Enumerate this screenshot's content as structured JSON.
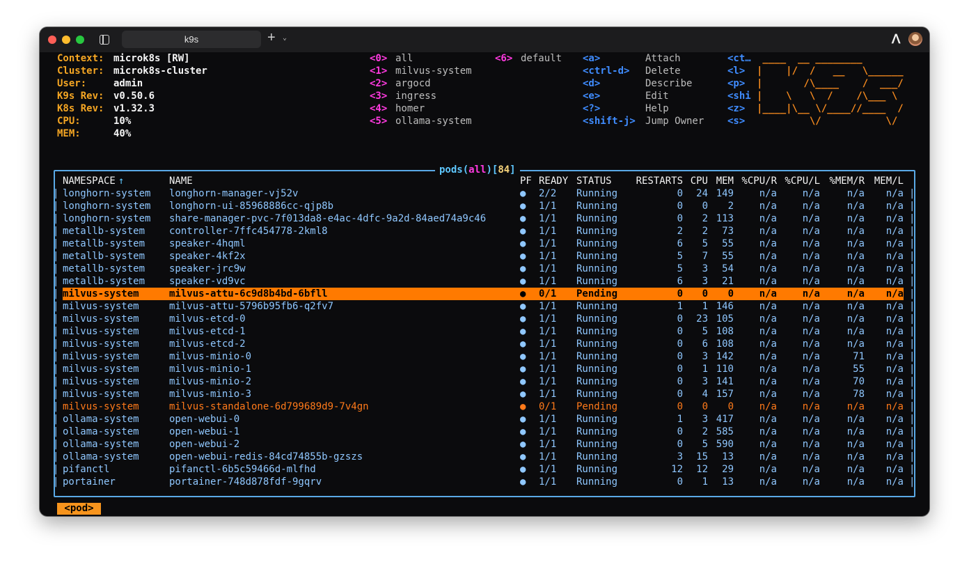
{
  "window": {
    "tab_title": "k9s"
  },
  "info": [
    {
      "label": "Context:",
      "value": "microk8s [RW]"
    },
    {
      "label": "Cluster:",
      "value": "microk8s-cluster"
    },
    {
      "label": "User:",
      "value": "admin"
    },
    {
      "label": "K9s Rev:",
      "value": "v0.50.6"
    },
    {
      "label": "K8s Rev:",
      "value": "v1.32.3"
    },
    {
      "label": "CPU:",
      "value": "10%"
    },
    {
      "label": "MEM:",
      "value": "40%"
    }
  ],
  "namespaces": [
    {
      "key": "<0>",
      "name": "all"
    },
    {
      "key": "<1>",
      "name": "milvus-system"
    },
    {
      "key": "<2>",
      "name": "argocd"
    },
    {
      "key": "<3>",
      "name": "ingress"
    },
    {
      "key": "<4>",
      "name": "homer"
    },
    {
      "key": "<5>",
      "name": "ollama-system"
    },
    {
      "key": "<6>",
      "name": "default"
    }
  ],
  "hotkeys": [
    {
      "key": "<a>",
      "action": "Attach"
    },
    {
      "key": "<ctrl-d>",
      "action": "Delete"
    },
    {
      "key": "<d>",
      "action": "Describe"
    },
    {
      "key": "<e>",
      "action": "Edit"
    },
    {
      "key": "<?>",
      "action": "Help"
    },
    {
      "key": "<shift-j>",
      "action": "Jump Owner"
    }
  ],
  "hotkeys2": [
    "<ct…",
    "<l>",
    "<p>",
    "<shi",
    "<z>",
    "<s>"
  ],
  "logo": [
    " ____  __ ________",
    "|    |/  /   __   \\______",
    "|       /\\____    /  ___/",
    "|    \\   \\  /    /\\___ \\",
    "|____|\\__ \\/____//____  /",
    "         \\/           \\/"
  ],
  "table": {
    "resource": "pods",
    "scope": "all",
    "count": "84",
    "headers": {
      "namespace": "NAMESPACE",
      "sort_arrow": "↑",
      "name": "NAME",
      "pf": "PF",
      "ready": "READY",
      "status": "STATUS",
      "restarts": "RESTARTS",
      "cpu": "CPU",
      "mem": "MEM",
      "cpu_r": "%CPU/R",
      "cpu_l": "%CPU/L",
      "mem_r": "%MEM/R",
      "mem_l": "MEM/L"
    },
    "rows": [
      {
        "ns": "longhorn-system",
        "name": "longhorn-manager-vj52v",
        "pf": "●",
        "ready": "2/2",
        "status": "Running",
        "restarts": "0",
        "cpu": "24",
        "mem": "149",
        "cpu_r": "n/a",
        "cpu_l": "n/a",
        "mem_r": "n/a",
        "mem_l": "n/a",
        "state": "ok"
      },
      {
        "ns": "longhorn-system",
        "name": "longhorn-ui-85968886cc-qjp8b",
        "pf": "●",
        "ready": "1/1",
        "status": "Running",
        "restarts": "0",
        "cpu": "0",
        "mem": "2",
        "cpu_r": "n/a",
        "cpu_l": "n/a",
        "mem_r": "n/a",
        "mem_l": "n/a",
        "state": "ok"
      },
      {
        "ns": "longhorn-system",
        "name": "share-manager-pvc-7f013da8-e4ac-4dfc-9a2d-84aed74a9c46",
        "pf": "●",
        "ready": "1/1",
        "status": "Running",
        "restarts": "0",
        "cpu": "2",
        "mem": "113",
        "cpu_r": "n/a",
        "cpu_l": "n/a",
        "mem_r": "n/a",
        "mem_l": "n/a",
        "state": "ok"
      },
      {
        "ns": "metallb-system",
        "name": "controller-7ffc454778-2kml8",
        "pf": "●",
        "ready": "1/1",
        "status": "Running",
        "restarts": "2",
        "cpu": "2",
        "mem": "73",
        "cpu_r": "n/a",
        "cpu_l": "n/a",
        "mem_r": "n/a",
        "mem_l": "n/a",
        "state": "ok"
      },
      {
        "ns": "metallb-system",
        "name": "speaker-4hqml",
        "pf": "●",
        "ready": "1/1",
        "status": "Running",
        "restarts": "6",
        "cpu": "5",
        "mem": "55",
        "cpu_r": "n/a",
        "cpu_l": "n/a",
        "mem_r": "n/a",
        "mem_l": "n/a",
        "state": "ok"
      },
      {
        "ns": "metallb-system",
        "name": "speaker-4kf2x",
        "pf": "●",
        "ready": "1/1",
        "status": "Running",
        "restarts": "5",
        "cpu": "7",
        "mem": "55",
        "cpu_r": "n/a",
        "cpu_l": "n/a",
        "mem_r": "n/a",
        "mem_l": "n/a",
        "state": "ok"
      },
      {
        "ns": "metallb-system",
        "name": "speaker-jrc9w",
        "pf": "●",
        "ready": "1/1",
        "status": "Running",
        "restarts": "5",
        "cpu": "3",
        "mem": "54",
        "cpu_r": "n/a",
        "cpu_l": "n/a",
        "mem_r": "n/a",
        "mem_l": "n/a",
        "state": "ok"
      },
      {
        "ns": "metallb-system",
        "name": "speaker-vd9vc",
        "pf": "●",
        "ready": "1/1",
        "status": "Running",
        "restarts": "6",
        "cpu": "3",
        "mem": "21",
        "cpu_r": "n/a",
        "cpu_l": "n/a",
        "mem_r": "n/a",
        "mem_l": "n/a",
        "state": "ok"
      },
      {
        "ns": "milvus-system",
        "name": "milvus-attu-6c9d8b4bd-6bfll",
        "pf": "●",
        "ready": "0/1",
        "status": "Pending",
        "restarts": "0",
        "cpu": "0",
        "mem": "0",
        "cpu_r": "n/a",
        "cpu_l": "n/a",
        "mem_r": "n/a",
        "mem_l": "n/a",
        "state": "selected"
      },
      {
        "ns": "milvus-system",
        "name": "milvus-attu-5796b95fb6-q2fv7",
        "pf": "●",
        "ready": "1/1",
        "status": "Running",
        "restarts": "1",
        "cpu": "1",
        "mem": "146",
        "cpu_r": "n/a",
        "cpu_l": "n/a",
        "mem_r": "n/a",
        "mem_l": "n/a",
        "state": "ok"
      },
      {
        "ns": "milvus-system",
        "name": "milvus-etcd-0",
        "pf": "●",
        "ready": "1/1",
        "status": "Running",
        "restarts": "0",
        "cpu": "23",
        "mem": "105",
        "cpu_r": "n/a",
        "cpu_l": "n/a",
        "mem_r": "n/a",
        "mem_l": "n/a",
        "state": "ok"
      },
      {
        "ns": "milvus-system",
        "name": "milvus-etcd-1",
        "pf": "●",
        "ready": "1/1",
        "status": "Running",
        "restarts": "0",
        "cpu": "5",
        "mem": "108",
        "cpu_r": "n/a",
        "cpu_l": "n/a",
        "mem_r": "n/a",
        "mem_l": "n/a",
        "state": "ok"
      },
      {
        "ns": "milvus-system",
        "name": "milvus-etcd-2",
        "pf": "●",
        "ready": "1/1",
        "status": "Running",
        "restarts": "0",
        "cpu": "6",
        "mem": "108",
        "cpu_r": "n/a",
        "cpu_l": "n/a",
        "mem_r": "n/a",
        "mem_l": "n/a",
        "state": "ok"
      },
      {
        "ns": "milvus-system",
        "name": "milvus-minio-0",
        "pf": "●",
        "ready": "1/1",
        "status": "Running",
        "restarts": "0",
        "cpu": "3",
        "mem": "142",
        "cpu_r": "n/a",
        "cpu_l": "n/a",
        "mem_r": "71",
        "mem_l": "n/a",
        "state": "ok"
      },
      {
        "ns": "milvus-system",
        "name": "milvus-minio-1",
        "pf": "●",
        "ready": "1/1",
        "status": "Running",
        "restarts": "0",
        "cpu": "1",
        "mem": "110",
        "cpu_r": "n/a",
        "cpu_l": "n/a",
        "mem_r": "55",
        "mem_l": "n/a",
        "state": "ok"
      },
      {
        "ns": "milvus-system",
        "name": "milvus-minio-2",
        "pf": "●",
        "ready": "1/1",
        "status": "Running",
        "restarts": "0",
        "cpu": "3",
        "mem": "141",
        "cpu_r": "n/a",
        "cpu_l": "n/a",
        "mem_r": "70",
        "mem_l": "n/a",
        "state": "ok"
      },
      {
        "ns": "milvus-system",
        "name": "milvus-minio-3",
        "pf": "●",
        "ready": "1/1",
        "status": "Running",
        "restarts": "0",
        "cpu": "4",
        "mem": "157",
        "cpu_r": "n/a",
        "cpu_l": "n/a",
        "mem_r": "78",
        "mem_l": "n/a",
        "state": "ok"
      },
      {
        "ns": "milvus-system",
        "name": "milvus-standalone-6d799689d9-7v4gn",
        "pf": "●",
        "ready": "0/1",
        "status": "Pending",
        "restarts": "0",
        "cpu": "0",
        "mem": "0",
        "cpu_r": "n/a",
        "cpu_l": "n/a",
        "mem_r": "n/a",
        "mem_l": "n/a",
        "state": "pending"
      },
      {
        "ns": "ollama-system",
        "name": "open-webui-0",
        "pf": "●",
        "ready": "1/1",
        "status": "Running",
        "restarts": "1",
        "cpu": "3",
        "mem": "417",
        "cpu_r": "n/a",
        "cpu_l": "n/a",
        "mem_r": "n/a",
        "mem_l": "n/a",
        "state": "ok"
      },
      {
        "ns": "ollama-system",
        "name": "open-webui-1",
        "pf": "●",
        "ready": "1/1",
        "status": "Running",
        "restarts": "0",
        "cpu": "2",
        "mem": "585",
        "cpu_r": "n/a",
        "cpu_l": "n/a",
        "mem_r": "n/a",
        "mem_l": "n/a",
        "state": "ok"
      },
      {
        "ns": "ollama-system",
        "name": "open-webui-2",
        "pf": "●",
        "ready": "1/1",
        "status": "Running",
        "restarts": "0",
        "cpu": "5",
        "mem": "590",
        "cpu_r": "n/a",
        "cpu_l": "n/a",
        "mem_r": "n/a",
        "mem_l": "n/a",
        "state": "ok"
      },
      {
        "ns": "ollama-system",
        "name": "open-webui-redis-84cd74855b-gzszs",
        "pf": "●",
        "ready": "1/1",
        "status": "Running",
        "restarts": "3",
        "cpu": "15",
        "mem": "13",
        "cpu_r": "n/a",
        "cpu_l": "n/a",
        "mem_r": "n/a",
        "mem_l": "n/a",
        "state": "ok"
      },
      {
        "ns": "pifanctl",
        "name": "pifanctl-6b5c59466d-mlfhd",
        "pf": "●",
        "ready": "1/1",
        "status": "Running",
        "restarts": "12",
        "cpu": "12",
        "mem": "29",
        "cpu_r": "n/a",
        "cpu_l": "n/a",
        "mem_r": "n/a",
        "mem_l": "n/a",
        "state": "ok"
      },
      {
        "ns": "portainer",
        "name": "portainer-748d878fdf-9gqrv",
        "pf": "●",
        "ready": "1/1",
        "status": "Running",
        "restarts": "0",
        "cpu": "1",
        "mem": "13",
        "cpu_r": "n/a",
        "cpu_l": "n/a",
        "mem_r": "n/a",
        "mem_l": "n/a",
        "state": "ok"
      }
    ]
  },
  "breadcrumb": "<pod>",
  "colors": {
    "label": "#f5a623",
    "ns_key": "#ff3ae0",
    "hotkey": "#3f8cff",
    "row_text": "#8fc7ff",
    "pending": "#ff7a1a",
    "selected_bg": "#ff7a00",
    "border": "#5aa9e6"
  }
}
